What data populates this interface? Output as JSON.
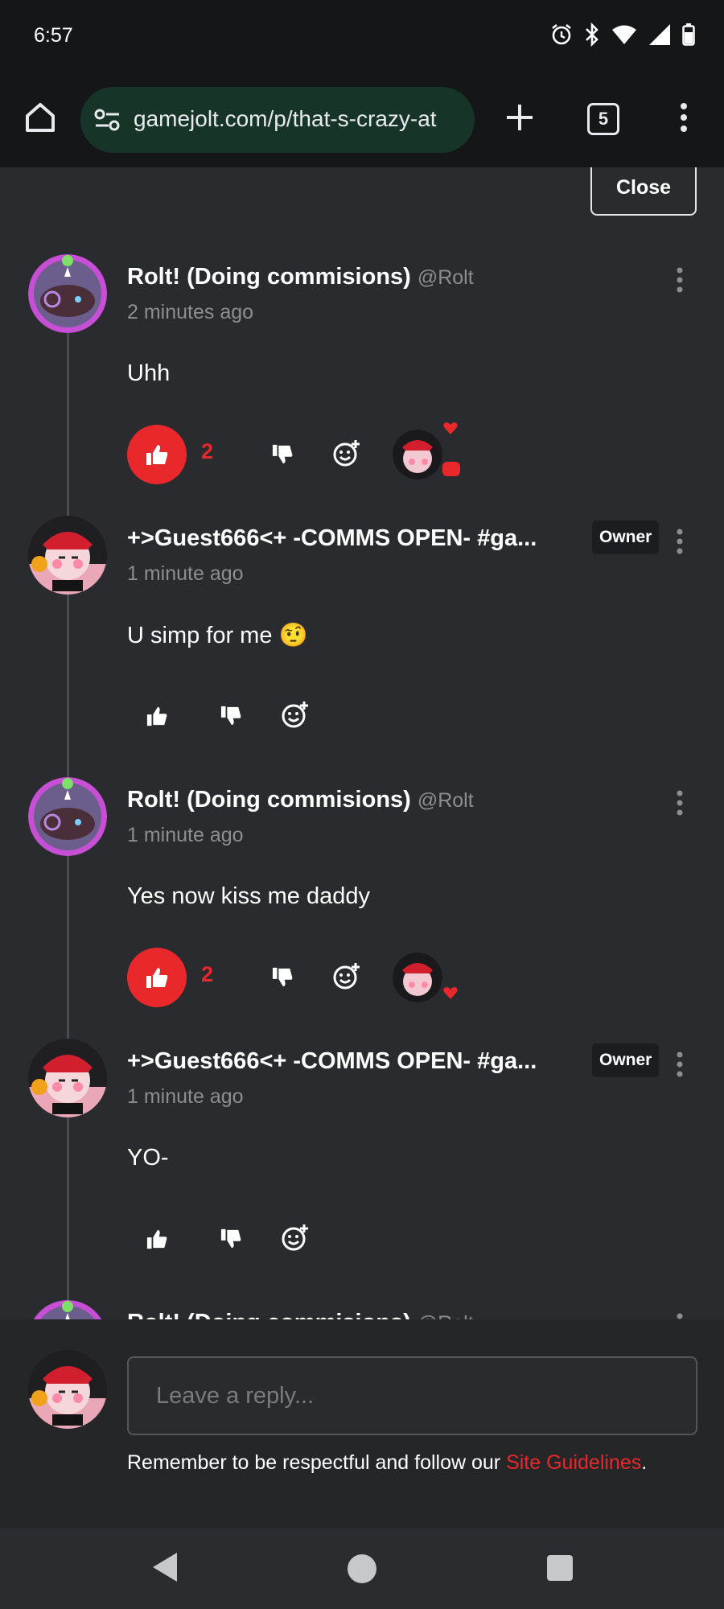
{
  "status_bar": {
    "time": "6:57",
    "icons": [
      "alarm-icon",
      "bluetooth-icon",
      "wifi-icon",
      "signal-icon",
      "battery-icon"
    ]
  },
  "browser": {
    "url": "gamejolt.com/p/that-s-crazy-at",
    "tab_count": "5"
  },
  "panel": {
    "close_label": "Close"
  },
  "colors": {
    "accent": "#e8282a",
    "background": "#2a2b2e",
    "muted_text": "#8d8e91"
  },
  "comments": [
    {
      "author": "Rolt! (Doing commisions)",
      "handle": "@Rolt",
      "owner": false,
      "time": "2 minutes ago",
      "text": "Uhh",
      "liked": true,
      "like_count": "2",
      "reactions": [
        "heart",
        "speech"
      ]
    },
    {
      "author": "+>Guest666<+ -COMMS OPEN- #ga...",
      "handle": "",
      "owner": true,
      "owner_label": "Owner",
      "time": "1 minute ago",
      "text": "U simp for me 🤨",
      "liked": false,
      "like_count": ""
    },
    {
      "author": "Rolt! (Doing commisions)",
      "handle": "@Rolt",
      "owner": false,
      "time": "1 minute ago",
      "text": "Yes now kiss me daddy",
      "liked": true,
      "like_count": "2",
      "reactions": [
        "heart"
      ]
    },
    {
      "author": "+>Guest666<+ -COMMS OPEN- #ga...",
      "handle": "",
      "owner": true,
      "owner_label": "Owner",
      "time": "1 minute ago",
      "text": "YO-",
      "liked": false,
      "like_count": ""
    },
    {
      "author": "Rolt! (Doing commisions)",
      "handle": "@Rolt"
    }
  ],
  "reply": {
    "placeholder": "Leave a reply...",
    "guidelines_prefix": "Remember to be respectful and follow our ",
    "guidelines_link": "Site Guidelines",
    "guidelines_suffix": "."
  }
}
